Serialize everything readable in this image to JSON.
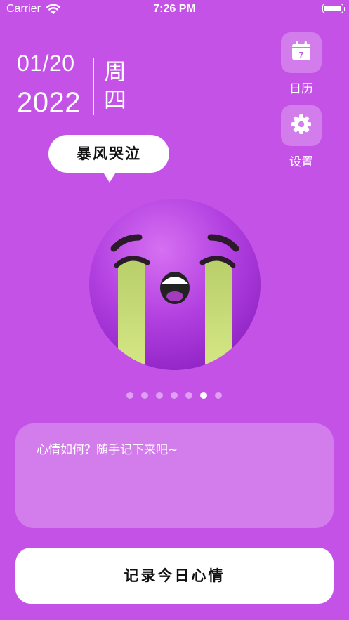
{
  "status_bar": {
    "carrier": "Carrier",
    "time": "7:26 PM",
    "wifi_icon": "wifi-icon",
    "battery_icon": "battery-full-icon"
  },
  "date": {
    "month_day": "01/20",
    "year": "2022",
    "weekday": "周四"
  },
  "side_actions": {
    "calendar": {
      "label": "日历",
      "icon": "calendar-icon",
      "icon_number": "7"
    },
    "settings": {
      "label": "设置",
      "icon": "gear-icon"
    }
  },
  "mood": {
    "label": "暴风哭泣",
    "emoji_icon": "loudly-crying-face-icon"
  },
  "carousel": {
    "page_count": 7,
    "active_index": 5
  },
  "note": {
    "placeholder": "心情如何？随手记下来吧~",
    "value": ""
  },
  "record_button": {
    "label": "记录今日心情"
  },
  "colors": {
    "background": "#c452e6",
    "emoji_purple": "#a430d8",
    "tears": "#cde07a"
  }
}
